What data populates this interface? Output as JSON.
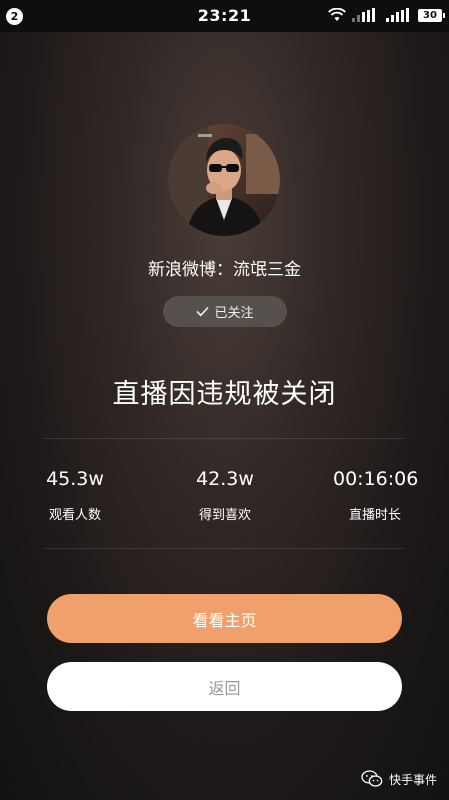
{
  "status_bar": {
    "notification_count": "2",
    "time": "23:21",
    "battery": "30",
    "icons": [
      "wifi-icon",
      "signal-icon",
      "signal-icon"
    ]
  },
  "profile": {
    "avatar_icon": "user-avatar-photo",
    "username": "新浪微博：流氓三金",
    "follow_label": "已关注",
    "follow_icon": "checkmark-icon"
  },
  "headline": "直播因违规被关闭",
  "stats": [
    {
      "value": "45.3w",
      "label": "观看人数"
    },
    {
      "value": "42.3w",
      "label": "得到喜欢"
    },
    {
      "value": "00:16:06",
      "label": "直播时长"
    }
  ],
  "actions": {
    "primary_label": "看看主页",
    "secondary_label": "返回"
  },
  "watermark": {
    "text": "快手事件",
    "icon": "wechat-icon"
  },
  "colors": {
    "primary_button": "#f0a06a",
    "follow_button": "#56504f",
    "background": "#1c1818"
  }
}
